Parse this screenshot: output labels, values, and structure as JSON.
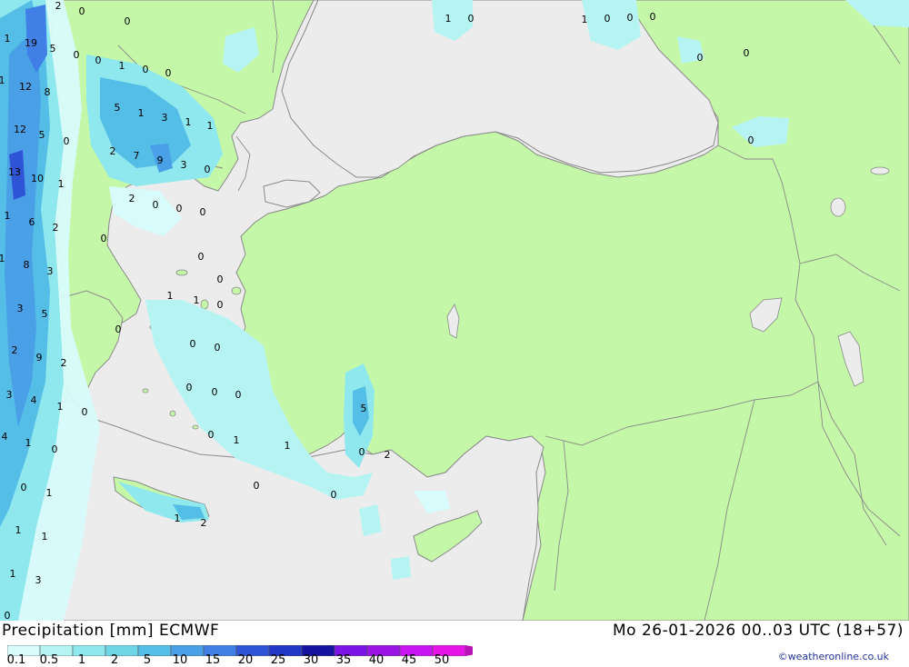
{
  "header": {
    "title": "Precipitation [mm] ECMWF",
    "datetime": "Mo 26-01-2026 00..03 UTC (18+57)"
  },
  "credit": "©weatheronline.co.uk",
  "colors": {
    "land": "#c5f7a8",
    "sea": "#ececec",
    "border": "#8a8a8a"
  },
  "legend": {
    "labels": [
      "0.1",
      "0.5",
      "1",
      "2",
      "5",
      "10",
      "15",
      "20",
      "25",
      "30",
      "35",
      "40",
      "45",
      "50"
    ],
    "colors": [
      "#d8fbfb",
      "#b6f4f4",
      "#8ee8ee",
      "#6fd6e6",
      "#55bee6",
      "#4aa0e6",
      "#3f7fe6",
      "#2f55d6",
      "#2236c8",
      "#1414a0",
      "#7c14e6",
      "#9a14e6",
      "#c814f0",
      "#e614e6",
      "#b814b8"
    ]
  },
  "values": [
    {
      "t": "2"
    },
    {
      "t": "0"
    },
    {
      "t": "0"
    },
    {
      "t": "1"
    },
    {
      "t": "19"
    },
    {
      "t": "5"
    },
    {
      "t": "0"
    },
    {
      "t": "0"
    },
    {
      "t": "1"
    },
    {
      "t": "0"
    },
    {
      "t": "0"
    },
    {
      "t": "1"
    },
    {
      "t": "12"
    },
    {
      "t": "8"
    },
    {
      "t": "5"
    },
    {
      "t": "1"
    },
    {
      "t": "3"
    },
    {
      "t": "1"
    },
    {
      "t": "1"
    },
    {
      "t": "12"
    },
    {
      "t": "5"
    },
    {
      "t": "0"
    },
    {
      "t": "2"
    },
    {
      "t": "7"
    },
    {
      "t": "9"
    },
    {
      "t": "3"
    },
    {
      "t": "0"
    },
    {
      "t": "13"
    },
    {
      "t": "10"
    },
    {
      "t": "1"
    },
    {
      "t": "2"
    },
    {
      "t": "0"
    },
    {
      "t": "0"
    },
    {
      "t": "0"
    },
    {
      "t": "1"
    },
    {
      "t": "6"
    },
    {
      "t": "2"
    },
    {
      "t": "0"
    },
    {
      "t": "0"
    },
    {
      "t": "1"
    },
    {
      "t": "8"
    },
    {
      "t": "3"
    },
    {
      "t": "0"
    },
    {
      "t": "1"
    },
    {
      "t": "1"
    },
    {
      "t": "0"
    },
    {
      "t": "3"
    },
    {
      "t": "5"
    },
    {
      "t": "0"
    },
    {
      "t": "0"
    },
    {
      "t": "0"
    },
    {
      "t": "2"
    },
    {
      "t": "9"
    },
    {
      "t": "2"
    },
    {
      "t": "3"
    },
    {
      "t": "4"
    },
    {
      "t": "1"
    },
    {
      "t": "0"
    },
    {
      "t": "0"
    },
    {
      "t": "0"
    },
    {
      "t": "0"
    },
    {
      "t": "5"
    },
    {
      "t": "4"
    },
    {
      "t": "1"
    },
    {
      "t": "0"
    },
    {
      "t": "0"
    },
    {
      "t": "1"
    },
    {
      "t": "1"
    },
    {
      "t": "0"
    },
    {
      "t": "2"
    },
    {
      "t": "0"
    },
    {
      "t": "1"
    },
    {
      "t": "0"
    },
    {
      "t": "0"
    },
    {
      "t": "1"
    },
    {
      "t": "2"
    },
    {
      "t": "1"
    },
    {
      "t": "1"
    },
    {
      "t": "1"
    },
    {
      "t": "3"
    },
    {
      "t": "0"
    },
    {
      "t": "1"
    },
    {
      "t": "0"
    },
    {
      "t": "1"
    },
    {
      "t": "0"
    },
    {
      "t": "0"
    },
    {
      "t": "0"
    },
    {
      "t": "0"
    },
    {
      "t": "0"
    },
    {
      "t": "0"
    }
  ]
}
